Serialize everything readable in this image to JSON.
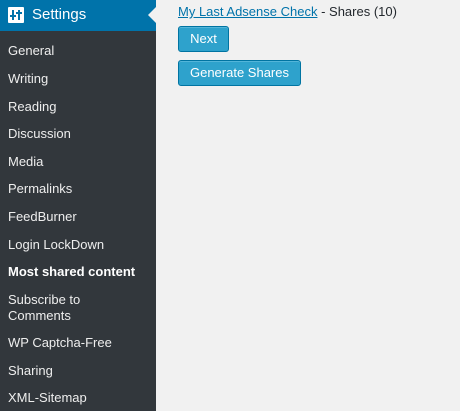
{
  "colors": {
    "sidebar_bg": "#32373c",
    "header_bg": "#0073aa",
    "button_bg": "#2ea2cc",
    "link": "#0073aa"
  },
  "sidebar": {
    "header": {
      "icon": "settings-icon",
      "label": "Settings"
    },
    "items": [
      {
        "label": "General"
      },
      {
        "label": "Writing"
      },
      {
        "label": "Reading"
      },
      {
        "label": "Discussion"
      },
      {
        "label": "Media"
      },
      {
        "label": "Permalinks"
      },
      {
        "label": "FeedBurner"
      },
      {
        "label": "Login LockDown"
      },
      {
        "label": "Most shared content",
        "current": true
      },
      {
        "label": "Subscribe to Comments"
      },
      {
        "label": "WP Captcha-Free"
      },
      {
        "label": "Sharing"
      },
      {
        "label": "XML-Sitemap"
      }
    ]
  },
  "main": {
    "post_link": "My Last Adsense Check",
    "shares_text": " - Shares (10)",
    "next_label": "Next",
    "generate_label": "Generate Shares"
  }
}
